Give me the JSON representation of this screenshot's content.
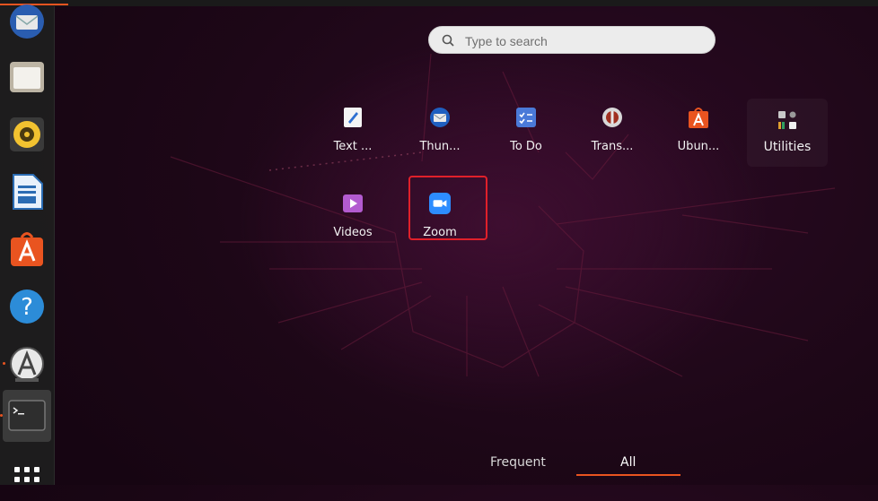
{
  "search": {
    "placeholder": "Type to search"
  },
  "apps_row1": [
    {
      "label": "Text ...",
      "icon": "text-editor-icon"
    },
    {
      "label": "Thun...",
      "icon": "thunderbird-icon"
    },
    {
      "label": "To Do",
      "icon": "todo-icon"
    },
    {
      "label": "Trans...",
      "icon": "transmission-icon"
    },
    {
      "label": "Ubun...",
      "icon": "ubuntu-software-icon"
    }
  ],
  "utilities": {
    "label": "Utilities",
    "icon": "utilities-folder-icon"
  },
  "apps_row2": [
    {
      "label": "Videos",
      "icon": "videos-icon"
    },
    {
      "label": "Zoom",
      "icon": "zoom-icon"
    }
  ],
  "tabs": {
    "frequent": "Frequent",
    "all": "All"
  },
  "dock": [
    "thunderbird-icon",
    "files-icon",
    "rhythmbox-icon",
    "libreoffice-writer-icon",
    "ubuntu-software-icon",
    "help-icon",
    "software-updater-icon",
    "terminal-icon",
    "show-applications-icon"
  ],
  "colors": {
    "accent": "#e95420",
    "highlight": "#e0202a",
    "zoom_blue": "#2d8cff"
  }
}
